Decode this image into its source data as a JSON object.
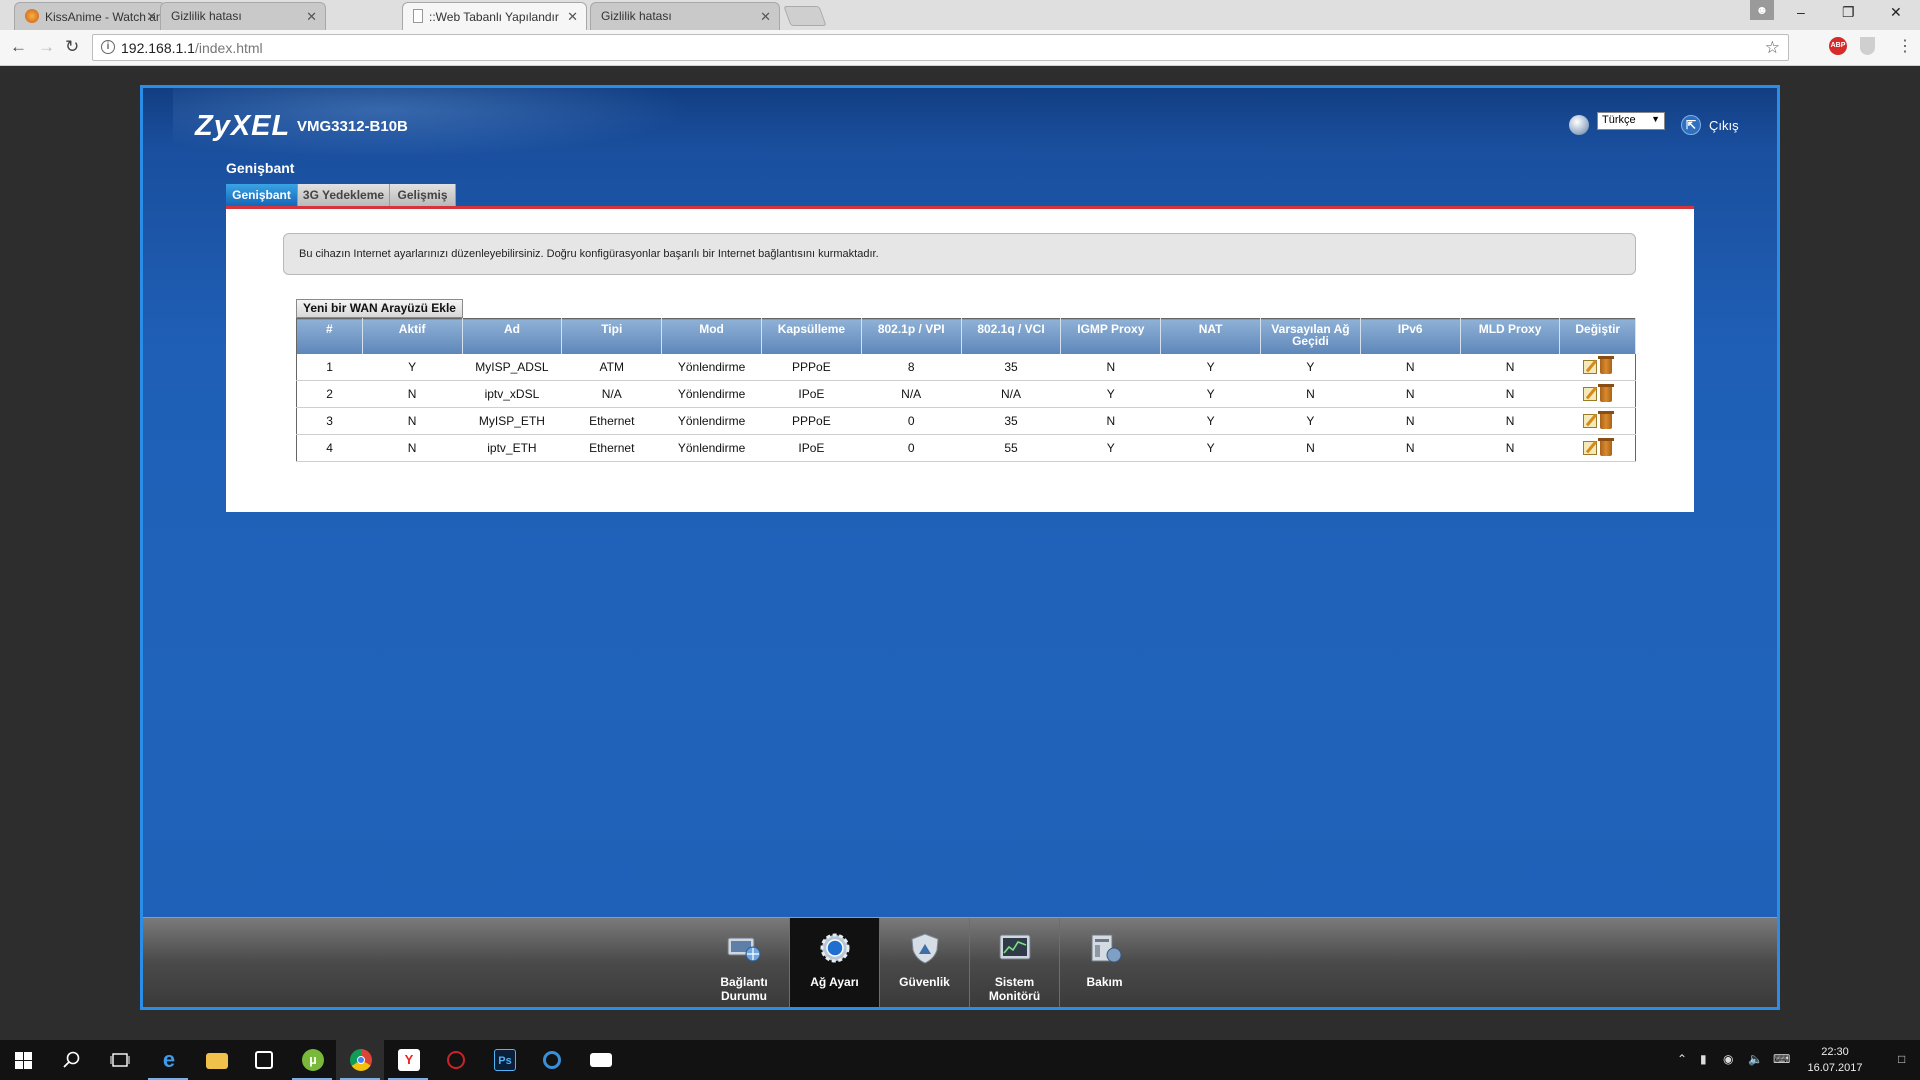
{
  "browser": {
    "tabs": [
      {
        "title": "KissAnime - Watch anim",
        "active": false
      },
      {
        "title": "Gizlilik hatası",
        "active": false
      },
      {
        "title": "::Web Tabanlı Yapılandır",
        "active": true
      },
      {
        "title": "Gizlilik hatası",
        "active": false
      }
    ],
    "url_host": "192.168.1.1",
    "url_path": "/index.html",
    "window_controls": {
      "minimize": "–",
      "restore": "❐",
      "close": "✕"
    },
    "close_glyph": "✕"
  },
  "router": {
    "brand": "ZyXEL",
    "model": "VMG3312-B10B",
    "language": "Türkçe",
    "logout_label": "Çıkış",
    "section_title": "Genişbant",
    "subtabs": [
      "Genişbant",
      "3G Yedekleme",
      "Gelişmiş"
    ],
    "notice": "Bu cihazın Internet ayarlarınızı düzenleyebilirsiniz. Doğru konfigürasyonlar başarılı bir Internet bağlantısını kurmaktadır.",
    "add_button": "Yeni bir WAN Arayüzü  Ekle",
    "table": {
      "headers": [
        "#",
        "Aktif",
        "Ad",
        "Tipi",
        "Mod",
        "Kapsülleme",
        "802.1p / VPI",
        "802.1q / VCI",
        "IGMP Proxy",
        "NAT",
        "Varsayılan Ağ Geçidi",
        "IPv6",
        "MLD Proxy",
        "Değiştir"
      ],
      "rows": [
        [
          "1",
          "Y",
          "MyISP_ADSL",
          "ATM",
          "Yönlendirme",
          "PPPoE",
          "8",
          "35",
          "N",
          "Y",
          "Y",
          "N",
          "N"
        ],
        [
          "2",
          "N",
          "iptv_xDSL",
          "N/A",
          "Yönlendirme",
          "IPoE",
          "N/A",
          "N/A",
          "Y",
          "Y",
          "N",
          "N",
          "N"
        ],
        [
          "3",
          "N",
          "MyISP_ETH",
          "Ethernet",
          "Yönlendirme",
          "PPPoE",
          "0",
          "35",
          "N",
          "Y",
          "Y",
          "N",
          "N"
        ],
        [
          "4",
          "N",
          "iptv_ETH",
          "Ethernet",
          "Yönlendirme",
          "IPoE",
          "0",
          "55",
          "Y",
          "Y",
          "N",
          "N",
          "N"
        ]
      ]
    },
    "bottom_nav": [
      {
        "label": "Bağlantı Durumu",
        "active": false
      },
      {
        "label": "Ağ Ayarı",
        "active": true
      },
      {
        "label": "Güvenlik",
        "active": false
      },
      {
        "label": "Sistem Monitörü",
        "active": false
      },
      {
        "label": "Bakım",
        "active": false
      }
    ]
  },
  "taskbar": {
    "time": "22:30",
    "date": "16.07.2017"
  }
}
